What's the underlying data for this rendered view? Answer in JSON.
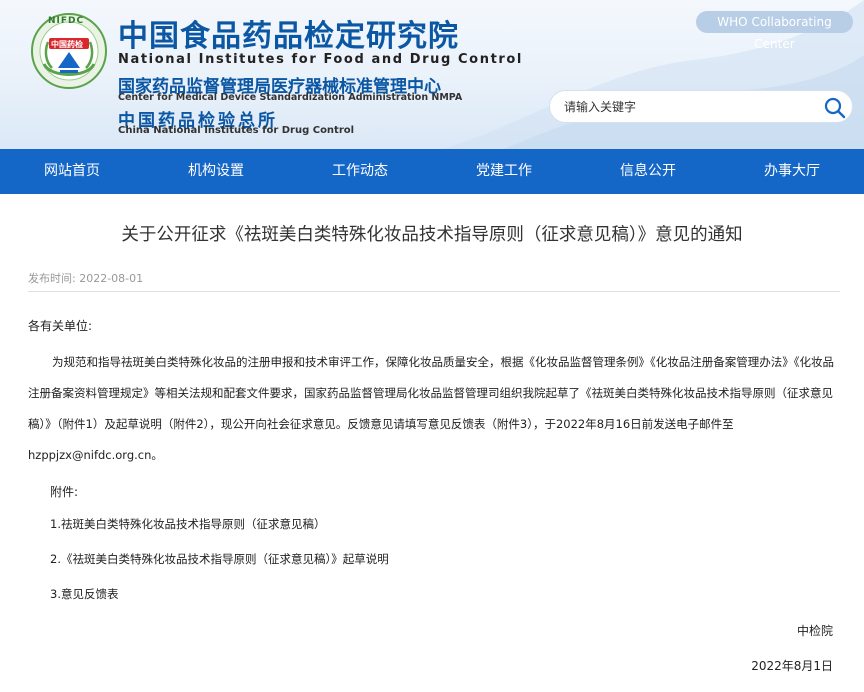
{
  "header": {
    "logo_text_top": "NIFDC",
    "logo_badge": "中国药检",
    "cn_title": "中国食品药品检定研究院",
    "en_title": "National Institutes for Food and Drug Control",
    "cn_sub1": "国家药品监督管理局医疗器械标准管理中心",
    "en_sub1": "Center for Medical Device Standardization Administration NMPA",
    "cn_sub2": "中国药品检验总所",
    "en_sub2": "China National Institutes for Drug Control",
    "who_badge": "WHO Collaborating Center",
    "search_placeholder": "请输入关键字"
  },
  "nav": {
    "items": [
      "网站首页",
      "机构设置",
      "工作动态",
      "党建工作",
      "信息公开",
      "办事大厅"
    ]
  },
  "article": {
    "title": "关于公开征求《祛斑美白类特殊化妆品技术指导原则（征求意见稿）》意见的通知",
    "meta": "发布时间:  2022-08-01",
    "salutation": "各有关单位:",
    "body": "为规范和指导祛斑美白类特殊化妆品的注册申报和技术审评工作，保障化妆品质量安全，根据《化妆品监督管理条例》《化妆品注册备案管理办法》《化妆品注册备案资料管理规定》等相关法规和配套文件要求，国家药品监督管理局化妆品监督管理司组织我院起草了《祛斑美白类特殊化妆品技术指导原则（征求意见稿）》（附件1）及起草说明（附件2），现公开向社会征求意见。反馈意见请填写意见反馈表（附件3），于2022年8月16日前发送电子邮件至hzppjzx@nifdc.org.cn。",
    "attachments_label": "附件:",
    "attachments": [
      "1.祛斑美白类特殊化妆品技术指导原则（征求意见稿）",
      "2.《祛斑美白类特殊化妆品技术指导原则（征求意见稿）》起草说明",
      "3.意见反馈表"
    ],
    "sign_org": "中检院",
    "sign_date": "2022年8月1日"
  },
  "colors": {
    "nav_bg": "#1466c7",
    "title_blue": "#0b57a4",
    "who_badge_bg": "#b8cde6"
  }
}
